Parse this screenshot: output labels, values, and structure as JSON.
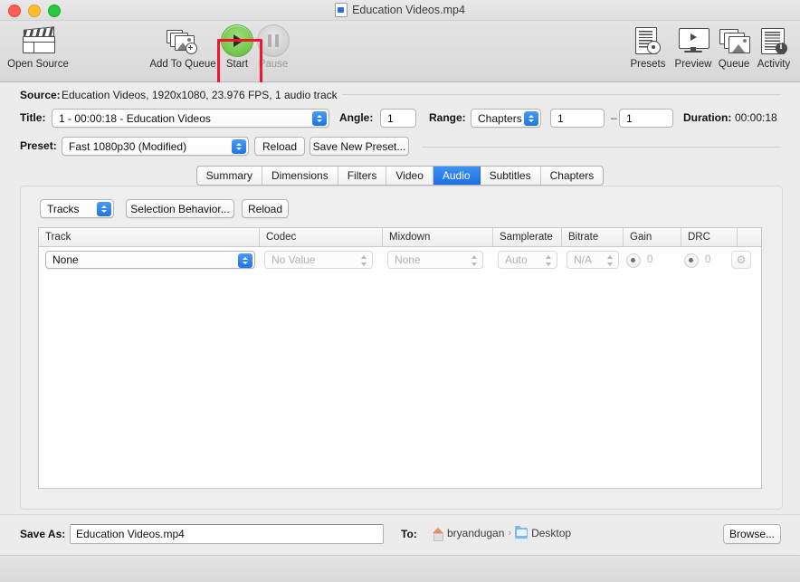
{
  "window": {
    "title": "Education Videos.mp4",
    "traffic_lights": [
      "close",
      "minimize",
      "zoom"
    ]
  },
  "toolbar": {
    "items": [
      {
        "label": "Open Source",
        "icon": "clapperboard-icon",
        "enabled": true
      },
      {
        "label": "Add To Queue",
        "icon": "add-to-queue-icon",
        "enabled": true
      },
      {
        "label": "Start",
        "icon": "start-icon",
        "enabled": true,
        "highlighted": true
      },
      {
        "label": "Pause",
        "icon": "pause-icon",
        "enabled": false
      },
      {
        "label": "Presets",
        "icon": "presets-icon",
        "enabled": true
      },
      {
        "label": "Preview",
        "icon": "preview-icon",
        "enabled": true
      },
      {
        "label": "Queue",
        "icon": "queue-icon",
        "enabled": true
      },
      {
        "label": "Activity",
        "icon": "activity-icon",
        "enabled": true
      }
    ],
    "highlight_color": "#f6132b"
  },
  "source": {
    "label": "Source:",
    "value": "Education Videos, 1920x1080, 23.976 FPS, 1 audio track"
  },
  "title_row": {
    "label": "Title:",
    "value": "1 - 00:00:18 - Education Videos",
    "angle_label": "Angle:",
    "angle_value": "1",
    "range_label": "Range:",
    "range_value": "Chapters",
    "range_start": "1",
    "range_dash": "–",
    "range_end": "1",
    "duration_label": "Duration:",
    "duration_value": "00:00:18"
  },
  "preset_row": {
    "label": "Preset:",
    "value": "Fast 1080p30 (Modified)",
    "reload_label": "Reload",
    "save_label": "Save New Preset..."
  },
  "tabs": {
    "items": [
      {
        "label": "Summary",
        "active": false
      },
      {
        "label": "Dimensions",
        "active": false
      },
      {
        "label": "Filters",
        "active": false
      },
      {
        "label": "Video",
        "active": false
      },
      {
        "label": "Audio",
        "active": true
      },
      {
        "label": "Subtitles",
        "active": false
      },
      {
        "label": "Chapters",
        "active": false
      }
    ],
    "active_color": "#2b7de8"
  },
  "audio_panel": {
    "tracks_popup": "Tracks",
    "selection_behavior_label": "Selection Behavior...",
    "reload_label": "Reload",
    "columns": [
      "Track",
      "Codec",
      "Mixdown",
      "Samplerate",
      "Bitrate",
      "Gain",
      "DRC",
      ""
    ],
    "rows": [
      {
        "track": "None",
        "codec": "No Value",
        "mixdown": "None",
        "samplerate": "Auto",
        "bitrate": "N/A",
        "gain": "0",
        "drc": "0",
        "settings_icon": "gear-icon"
      }
    ]
  },
  "bottom": {
    "save_as_label": "Save As:",
    "save_as_value": "Education Videos.mp4",
    "to_label": "To:",
    "path": [
      {
        "name": "bryandugan",
        "icon": "home-icon"
      },
      {
        "name": "Desktop",
        "icon": "folder-icon"
      }
    ],
    "path_separator": "›",
    "browse_label": "Browse..."
  }
}
